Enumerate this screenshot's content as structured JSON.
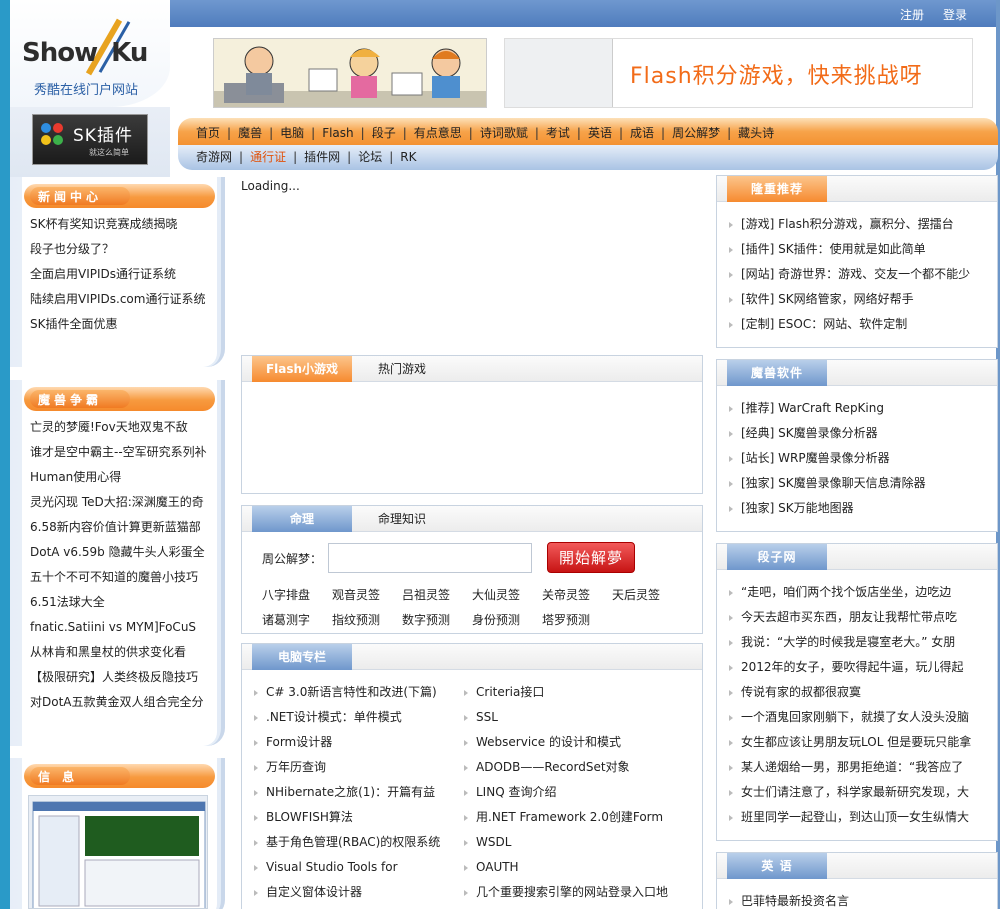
{
  "top": {
    "register": "注册",
    "login": "登录"
  },
  "logo": {
    "show": "Show",
    "ku": "Ku",
    "sub": "秀酷在线门户网站"
  },
  "sk_badge": {
    "title": "SK插件",
    "slogan": "就这么简单"
  },
  "banner": {
    "ad_text": "Flash积分游戏，快来挑战呀"
  },
  "nav": {
    "row1": [
      "首页",
      "魔兽",
      "电脑",
      "Flash",
      "段子",
      "有点意思",
      "诗词歌赋",
      "考试",
      "英语",
      "成语",
      "周公解梦",
      "藏头诗"
    ],
    "row2": [
      "奇游网",
      "通行证",
      "插件网",
      "论坛",
      "RK"
    ],
    "row2_highlight": "通行证"
  },
  "left": {
    "news": {
      "title": "新闻中心",
      "items": [
        "SK杯有奖知识竞赛成绩揭晓",
        "段子也分级了？",
        "全面启用VIPIDs通行证系统",
        "陆续启用VIPIDs.com通行证系统",
        "SK插件全面优惠"
      ]
    },
    "war": {
      "title": "魔兽争霸",
      "items": [
        "亡灵的梦魇!Fov天地双鬼不敌",
        "谁才是空中霸主--空军研究系列补",
        "Human使用心得",
        "灵光闪现 TeD大招:深渊魔王的奇",
        "6.58新内容价值计算更新蓝猫部",
        "DotA v6.59b 隐藏牛头人彩蛋全",
        "五十个不可不知道的魔兽小技巧",
        "6.51法球大全",
        "fnatic.Satiini vs MYM]FoCuS",
        "从林肯和黑皇杖的供求变化看",
        "【极限研究】人类终极反隐技巧",
        "对DotA五款黄金双人组合完全分"
      ]
    },
    "info": {
      "title": "信 息"
    }
  },
  "center": {
    "loading": "Loading...",
    "flash": {
      "tab_active": "Flash小游戏",
      "tab_other": "热门游戏"
    },
    "ming": {
      "tab_active": "命理",
      "tab_other": "命理知识",
      "label": "周公解梦：",
      "input_value": "",
      "button": "開始解夢",
      "items_row1": [
        "八字排盘",
        "观音灵签",
        "吕祖灵签",
        "大仙灵签",
        "关帝灵签",
        "天后灵签"
      ],
      "items_row2": [
        "诸葛测字",
        "指纹预测",
        "数字预测",
        "身份预测",
        "塔罗预测"
      ]
    },
    "pc": {
      "title": "电脑专栏",
      "left": [
        "C# 3.0新语言特性和改进(下篇)",
        ".NET设计模式：单件模式",
        "Form设计器",
        "万年历查询",
        "NHibernate之旅(1)：开篇有益",
        "BLOWFISH算法",
        "基于角色管理(RBAC)的权限系统",
        "Visual Studio Tools for",
        "自定义窗体设计器"
      ],
      "right": [
        "Criteria接口",
        "SSL",
        "Webservice 的设计和模式",
        "ADODB——RecordSet对象",
        "LINQ 查询介绍",
        "用.NET Framework 2.0创建Form",
        "WSDL",
        "OAUTH",
        "几个重要搜索引擎的网站登录入口地"
      ]
    }
  },
  "right": {
    "recommend": {
      "title": "隆重推荐",
      "items": [
        "[游戏] Flash积分游戏，赢积分、摆擂台",
        "[插件] SK插件：使用就是如此简单",
        "[网站] 奇游世界：游戏、交友一个都不能少",
        "[软件] SK网络管家，网络好帮手",
        "[定制] ESOC：网站、软件定制"
      ]
    },
    "war_soft": {
      "title": "魔兽软件",
      "items": [
        "[推荐] WarCraft RepKing",
        "[经典] SK魔兽录像分析器",
        "[站长] WRP魔兽录像分析器",
        "[独家] SK魔兽录像聊天信息清除器",
        "[独家] SK万能地图器"
      ]
    },
    "jokes": {
      "title": "段子网",
      "items": [
        "“走吧，咱们两个找个饭店坐坐，边吃边",
        "今天去超市买东西，朋友让我帮忙带点吃",
        "我说：“大学的时候我是寝室老大。” 女朋",
        "2012年的女子，要吹得起牛逼，玩儿得起",
        "传说有家的叔都很寂寞",
        "一个酒鬼回家刚躺下，就摸了女人没头没脑",
        "女生都应该让男朋友玩LOL 但是要玩只能拿",
        "某人递烟给一男，那男拒绝道：“我答应了",
        "女士们请注意了，科学家最新研究发现，大",
        "班里同学一起登山，到达山顶一女生纵情大"
      ]
    },
    "english": {
      "title": "英 语",
      "items": [
        "巴菲特最新投资名言"
      ]
    }
  },
  "colors": {
    "orange": "#f68a2f",
    "blue": "#6f97cc",
    "top_blue": "#4f7cbd"
  }
}
